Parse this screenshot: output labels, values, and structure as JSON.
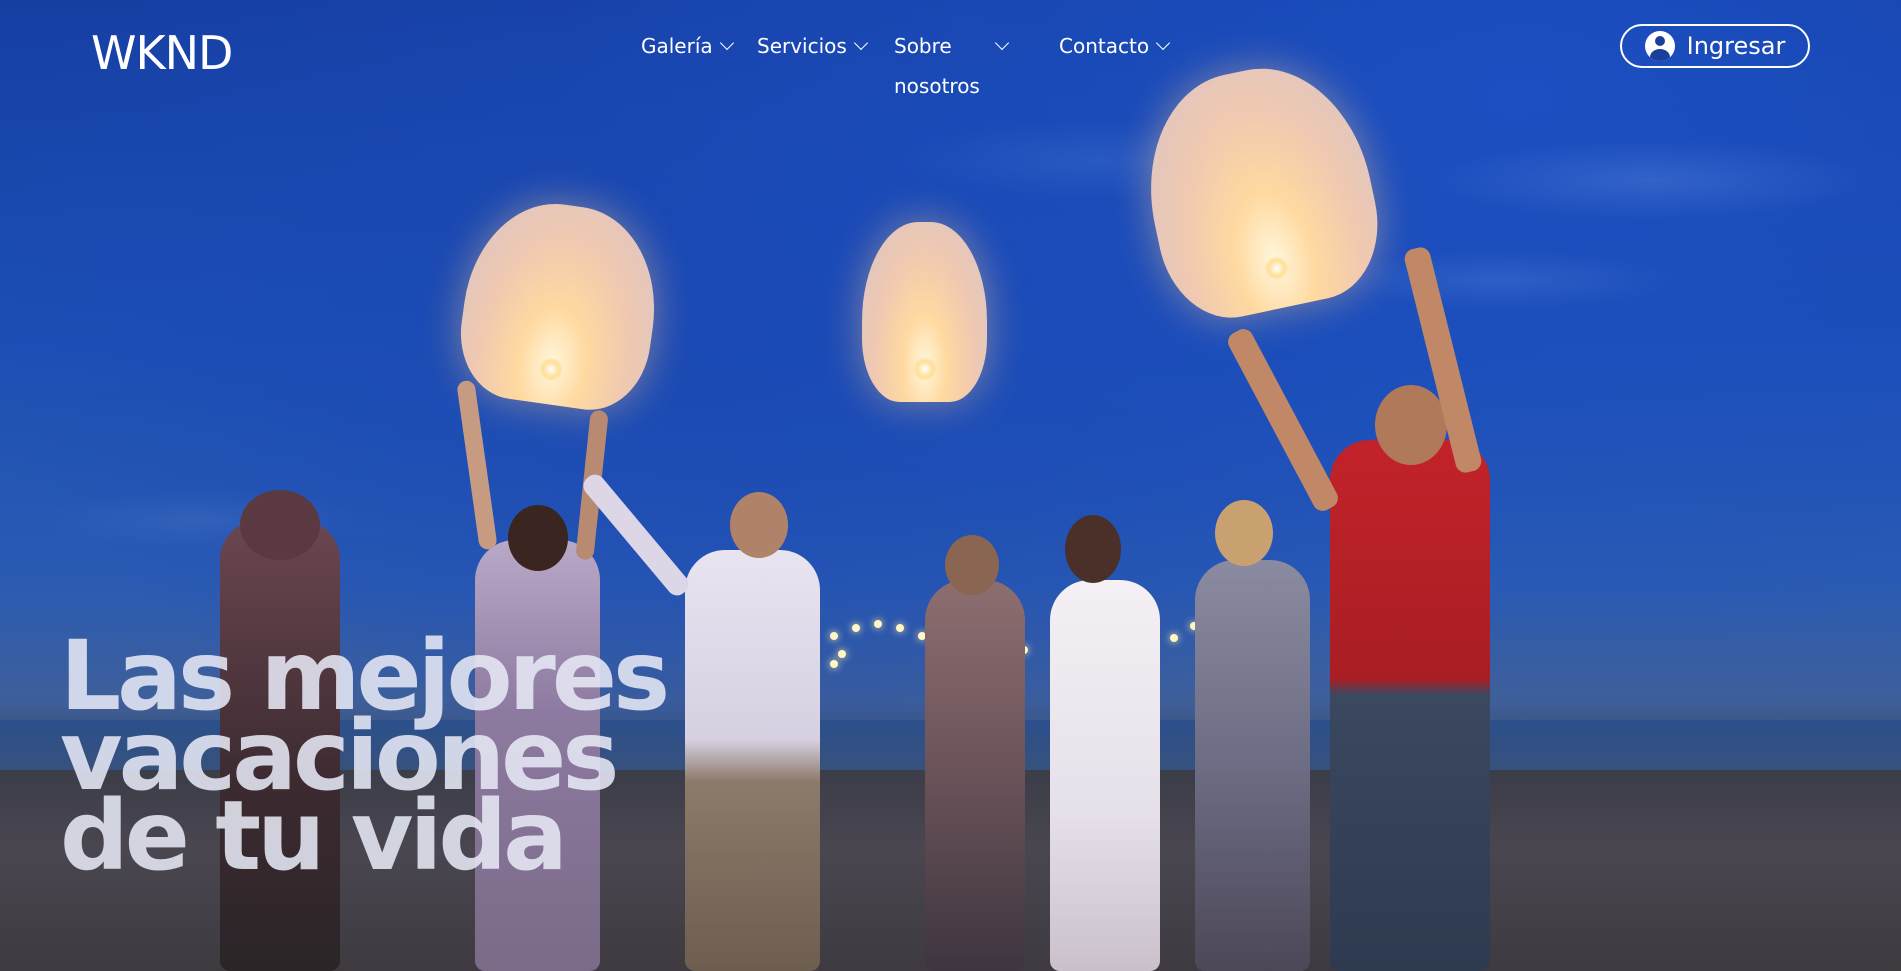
{
  "brand": {
    "logo": "WKND"
  },
  "nav": {
    "items": [
      {
        "label": "Galería"
      },
      {
        "label": "Servicios"
      },
      {
        "label": "Sobre",
        "label_line2": "nosotros"
      },
      {
        "label": "Contacto"
      }
    ]
  },
  "account": {
    "login_label": "Ingresar",
    "icon": "user-circle-icon"
  },
  "hero": {
    "headline_lines": [
      "Las mejores",
      "vacaciones",
      "de tu vida"
    ],
    "image_description_icon": "beach-sky-lanterns-photo"
  },
  "colors": {
    "sky": "#1c4fb5",
    "text": "#ffffff"
  }
}
